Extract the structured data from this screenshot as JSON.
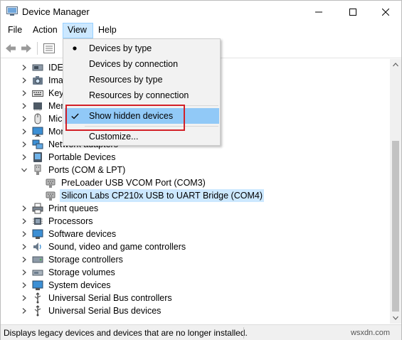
{
  "window": {
    "title": "Device Manager"
  },
  "menubar": {
    "items": [
      "File",
      "Action",
      "View",
      "Help"
    ]
  },
  "view_menu": {
    "items": [
      {
        "label": "Devices by type",
        "mark": "bullet"
      },
      {
        "label": "Devices by connection",
        "mark": ""
      },
      {
        "label": "Resources by type",
        "mark": ""
      },
      {
        "label": "Resources by connection",
        "mark": ""
      },
      {
        "label": "Show hidden devices",
        "mark": "check"
      },
      {
        "label": "Customize...",
        "mark": ""
      }
    ],
    "highlighted": "Show hidden devices"
  },
  "tree": {
    "items": [
      {
        "label": "IDE ATA/ATAPI controllers",
        "visible": "IDE A",
        "icon": "ide-icon",
        "state": "collapsed"
      },
      {
        "label": "Imaging devices",
        "visible": "Imag",
        "icon": "camera-icon",
        "state": "collapsed"
      },
      {
        "label": "Keyboards",
        "visible": "Keyb",
        "icon": "keyboard-icon",
        "state": "collapsed"
      },
      {
        "label": "Memory technology devices",
        "visible": "Mem",
        "icon": "memory-icon",
        "state": "collapsed"
      },
      {
        "label": "Mice and other pointing devices",
        "visible": "Mice",
        "icon": "mouse-icon",
        "state": "collapsed"
      },
      {
        "label": "Monitors",
        "visible": "Mon",
        "icon": "monitor-icon",
        "state": "collapsed"
      },
      {
        "label": "Network adapters",
        "visible": "Network adapters",
        "icon": "network-icon",
        "state": "collapsed"
      },
      {
        "label": "Portable Devices",
        "visible": "Portable Devices",
        "icon": "portable-device-icon",
        "state": "collapsed"
      },
      {
        "label": "Ports (COM & LPT)",
        "visible": "Ports (COM & LPT)",
        "icon": "port-icon",
        "state": "expanded"
      },
      {
        "label": "PreLoader USB VCOM Port (COM3)",
        "visible": "PreLoader USB VCOM Port (COM3)",
        "icon": "port-device-icon",
        "state": "child"
      },
      {
        "label": "Silicon Labs CP210x USB to UART Bridge (COM4)",
        "visible": "Silicon Labs CP210x USB to UART Bridge (COM4)",
        "icon": "port-device-icon",
        "state": "child-selected"
      },
      {
        "label": "Print queues",
        "visible": "Print queues",
        "icon": "printer-icon",
        "state": "collapsed"
      },
      {
        "label": "Processors",
        "visible": "Processors",
        "icon": "processor-icon",
        "state": "collapsed"
      },
      {
        "label": "Software devices",
        "visible": "Software devices",
        "icon": "software-device-icon",
        "state": "collapsed"
      },
      {
        "label": "Sound, video and game controllers",
        "visible": "Sound, video and game controllers",
        "icon": "sound-icon",
        "state": "collapsed"
      },
      {
        "label": "Storage controllers",
        "visible": "Storage controllers",
        "icon": "storage-controller-icon",
        "state": "collapsed"
      },
      {
        "label": "Storage volumes",
        "visible": "Storage volumes",
        "icon": "storage-volume-icon",
        "state": "collapsed"
      },
      {
        "label": "System devices",
        "visible": "System devices",
        "icon": "system-device-icon",
        "state": "collapsed"
      },
      {
        "label": "Universal Serial Bus controllers",
        "visible": "Universal Serial Bus controllers",
        "icon": "usb-icon",
        "state": "collapsed"
      },
      {
        "label": "Universal Serial Bus devices",
        "visible": "Universal Serial Bus devices",
        "icon": "usb-icon",
        "state": "collapsed"
      }
    ]
  },
  "status": {
    "text": "Displays legacy devices and devices that are no longer installed.",
    "watermark": "wsxdn.com"
  },
  "colors": {
    "selection": "#cce8ff",
    "menu_highlight": "#91c9f7",
    "annotation_red": "#d32027"
  }
}
